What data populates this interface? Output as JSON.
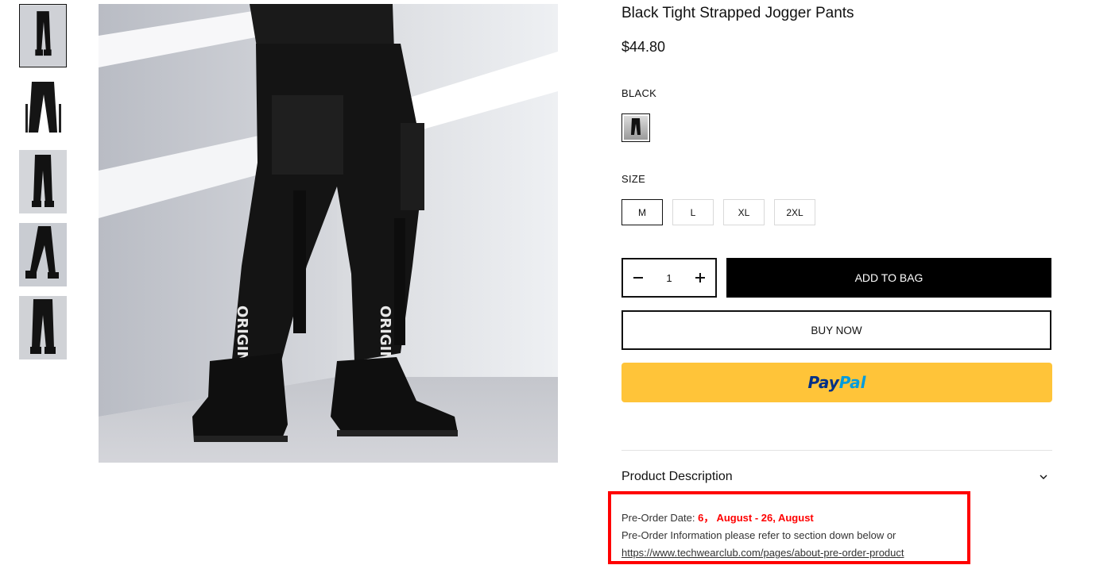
{
  "product": {
    "title": "Black Tight Strapped Jogger Pants",
    "price": "$44.80"
  },
  "thumbnails": [
    {
      "alt": "front view",
      "active": true
    },
    {
      "alt": "flat lay",
      "active": false
    },
    {
      "alt": "back view",
      "active": false
    },
    {
      "alt": "side view",
      "active": false
    },
    {
      "alt": "detail view",
      "active": false
    }
  ],
  "variant": {
    "color_label": "BLACK",
    "size_label": "SIZE",
    "sizes": [
      "M",
      "L",
      "XL",
      "2XL"
    ],
    "selected_size": "M"
  },
  "purchase": {
    "quantity": "1",
    "add_to_bag": "ADD TO BAG",
    "buy_now": "BUY NOW",
    "paypal_part1": "Pay",
    "paypal_part2": "Pal"
  },
  "description": {
    "title": "Product Description",
    "preorder_prefix": "Pre-Order Date: ",
    "preorder_dates": "6，  August - 26, August",
    "preorder_info": "Pre-Order Information please refer to section down below or",
    "preorder_link": "https://www.techwearclub.com/pages/about-pre-order-product"
  },
  "colors": {
    "accent_black": "#000000",
    "paypal_yellow": "#ffc439",
    "paypal_dark": "#003087",
    "paypal_light": "#009cde",
    "highlight_red": "#ff0000"
  }
}
